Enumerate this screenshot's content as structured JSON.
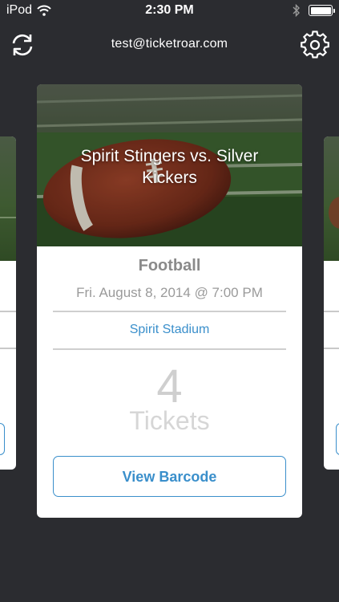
{
  "status_bar": {
    "carrier": "iPod",
    "time": "2:30 PM"
  },
  "nav": {
    "account_email": "test@ticketroar.com",
    "refresh_icon": "refresh-icon",
    "settings_icon": "gear-icon"
  },
  "ticket_card": {
    "event_title": "Spirit Stingers vs. Silver Kickers",
    "sport": "Football",
    "date": "Fri. August 8, 2014 @ 7:00 PM",
    "venue": "Spirit Stadium",
    "ticket_count": "4",
    "ticket_label": "Tickets",
    "barcode_button_label": "View Barcode"
  },
  "colors": {
    "background": "#2b2c30",
    "accent": "#3a8fcb"
  }
}
